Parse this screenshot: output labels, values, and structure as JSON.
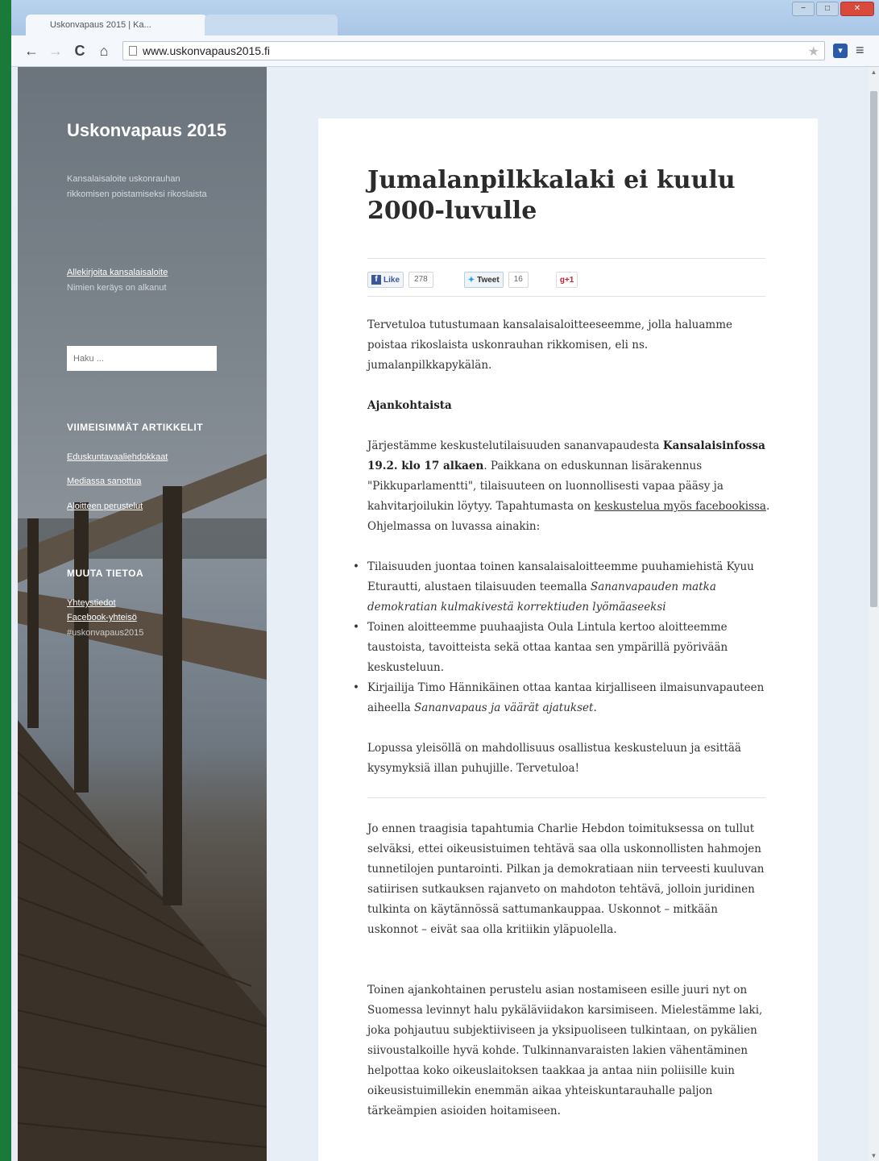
{
  "browser": {
    "tab_active": "Uskonvapaus 2015 | Ka...",
    "tab_inactive": "",
    "url": "www.uskonvapaus2015.fi",
    "back_icon": "←",
    "forward_icon": "→",
    "reload_icon": "C",
    "home_icon": "⌂",
    "star_icon": "★",
    "menu_icon": "≡",
    "minimize": "−",
    "maximize": "□",
    "close": "✕"
  },
  "sidebar": {
    "site_title": "Uskonvapaus 2015",
    "site_description": "Kansalaisaloite uskonrauhan rikkomisen poistamiseksi rikoslaista",
    "petition_link": "Allekirjoita kansalaisaloite",
    "petition_sub": "Nimien keräys on alkanut",
    "search_placeholder": "Haku ...",
    "recent_title": "VIIMEISIMMÄT ARTIKKELIT",
    "recent_items": [
      "Eduskuntavaaliehdokkaat",
      "Mediassa sanottua",
      "Aloitteen perustelut"
    ],
    "other_title": "MUUTA TIETOA",
    "other_items": [
      "Yhteystiedot",
      "Facebook-yhteisö"
    ],
    "other_text": "#uskonvapaus2015"
  },
  "article": {
    "title": "Jumalanpilkkalaki ei kuulu 2000-luvulle",
    "share": {
      "like_label": "Like",
      "like_count": "278",
      "tweet_label": "Tweet",
      "tweet_count": "16",
      "gplus_label": "+1"
    },
    "intro": "Tervetuloa tutustumaan kansalaisaloitteeseemme, jolla haluamme poistaa rikoslaista uskonrauhan rikkomisen, eli ns. jumalanpilkkapykälän.",
    "news_heading": "Ajankohtaista",
    "event_p1": "Järjestämme keskustelutilaisuuden sananvapaudesta ",
    "event_bold": "Kansalaisinfossa 19.2. klo 17 alkaen",
    "event_p2": ". Paikkana on eduskunnan lisärakennus \"Pikkuparlamentti\", tilaisuuteen on luonnollisesti vapaa pääsy ja kahvitarjoilukin löytyy. Tapahtumasta on ",
    "event_link": "keskustelua myös facebookissa",
    "event_p3": ". Ohjelmassa on luvassa ainakin:",
    "bullet1_a": "Tilaisuuden juontaa toinen kansalaisaloitteemme puuhamiehistä Kyuu Eturautti, alustaen tilaisuuden teemalla ",
    "bullet1_em": "Sananvapauden matka demokratian kulmakivestä korrektiuden lyömäaseeksi",
    "bullet2": "Toinen aloitteemme puuhaajista Oula Lintula kertoo aloitteemme taustoista, tavoitteista sekä ottaa kantaa sen ympärillä pyörivään keskusteluun.",
    "bullet3_a": "Kirjailija Timo Hännikäinen ottaa kantaa kirjalliseen ilmaisunvapauteen aiheella ",
    "bullet3_em": "Sananvapaus ja väärät ajatukset",
    "bullet3_b": ".",
    "closing": "Lopussa yleisöllä on mahdollisuus osallistua keskusteluun ja esittää kysymyksiä illan puhujille. Tervetuloa!",
    "para1": "Jo ennen traagisia tapahtumia Charlie Hebdon toimituksessa on tullut selväksi, ettei oikeusistuimen tehtävä saa olla uskonnollisten hahmojen tunnetilojen puntarointi. Pilkan ja demokratiaan niin terveesti kuuluvan satiirisen sutkauksen rajanveto on mahdoton tehtävä, jolloin juridinen tulkinta on käytännössä sattumankauppaa. Uskonnot – mitkään uskonnot – eivät saa olla kritiikin yläpuolella.",
    "para2": "Toinen ajankohtainen perustelu asian nostamiseen esille juuri nyt on Suomessa levinnyt halu pykäläviidakon karsimiseen. Mielestämme laki, joka pohjautuu subjektiiviseen ja yksipuoliseen tulkintaan, on pykälien siivoustalkoille hyvä kohde. Tulkinnanvaraisten lakien vähentäminen helpottaa koko oikeuslaitoksen taakkaa ja antaa niin poliisille kuin oikeusistuimillekin enemmän aikaa yhteiskuntarauhalle paljon tärkeämpien asioiden hoitamiseen."
  }
}
